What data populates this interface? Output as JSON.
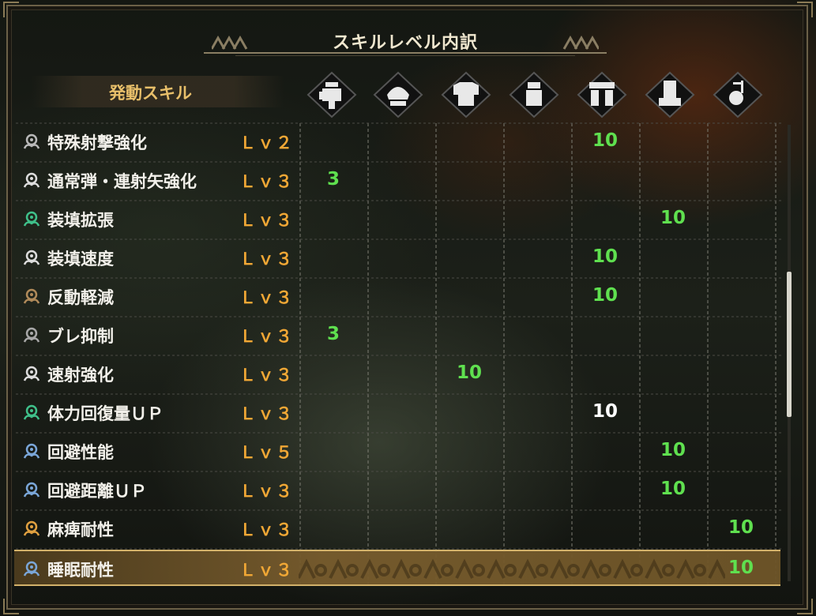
{
  "title": "スキルレベル内訳",
  "header_label": "発動スキル",
  "colors": {
    "value_green": "#5fe04f",
    "value_white": "#ffffff",
    "level_orange": "#f0a735",
    "header_gold": "#e8bf6a"
  },
  "equipment_slots": [
    {
      "name": "weapon-icon"
    },
    {
      "name": "helm-icon"
    },
    {
      "name": "chest-icon"
    },
    {
      "name": "arms-icon"
    },
    {
      "name": "waist-icon"
    },
    {
      "name": "legs-icon"
    },
    {
      "name": "talisman-icon"
    }
  ],
  "skills": [
    {
      "name": "特殊射撃強化",
      "level": "Ｌｖ２",
      "icon_color": "#b9b9b9",
      "values": [
        "",
        "",
        "",
        "",
        "10",
        "",
        ""
      ],
      "white_cols": []
    },
    {
      "name": "通常弾・連射矢強化",
      "level": "Ｌｖ３",
      "icon_color": "#dcdcdc",
      "values": [
        "3",
        "",
        "",
        "",
        "",
        "",
        ""
      ],
      "white_cols": []
    },
    {
      "name": "装填拡張",
      "level": "Ｌｖ３",
      "icon_color": "#3fc08a",
      "values": [
        "",
        "",
        "",
        "",
        "",
        "10",
        ""
      ],
      "white_cols": []
    },
    {
      "name": "装填速度",
      "level": "Ｌｖ３",
      "icon_color": "#dcdcdc",
      "values": [
        "",
        "",
        "",
        "",
        "10",
        "",
        ""
      ],
      "white_cols": []
    },
    {
      "name": "反動軽減",
      "level": "Ｌｖ３",
      "icon_color": "#b08a5a",
      "values": [
        "",
        "",
        "",
        "",
        "10",
        "",
        ""
      ],
      "white_cols": []
    },
    {
      "name": "ブレ抑制",
      "level": "Ｌｖ３",
      "icon_color": "#a7a7a7",
      "values": [
        "3",
        "",
        "",
        "",
        "",
        "",
        ""
      ],
      "white_cols": []
    },
    {
      "name": "速射強化",
      "level": "Ｌｖ３",
      "icon_color": "#dcdcdc",
      "values": [
        "",
        "",
        "10",
        "",
        "",
        "",
        ""
      ],
      "white_cols": []
    },
    {
      "name": "体力回復量ＵＰ",
      "level": "Ｌｖ３",
      "icon_color": "#3fc08a",
      "values": [
        "",
        "",
        "",
        "",
        "10",
        "",
        ""
      ],
      "white_cols": [
        4
      ]
    },
    {
      "name": "回避性能",
      "level": "Ｌｖ５",
      "icon_color": "#7aa6d8",
      "values": [
        "",
        "",
        "",
        "",
        "",
        "10",
        ""
      ],
      "white_cols": []
    },
    {
      "name": "回避距離ＵＰ",
      "level": "Ｌｖ３",
      "icon_color": "#7aa6d8",
      "values": [
        "",
        "",
        "",
        "",
        "",
        "10",
        ""
      ],
      "white_cols": []
    },
    {
      "name": "麻痺耐性",
      "level": "Ｌｖ３",
      "icon_color": "#e0a040",
      "values": [
        "",
        "",
        "",
        "",
        "",
        "",
        "10"
      ],
      "white_cols": []
    },
    {
      "name": "睡眠耐性",
      "level": "Ｌｖ３",
      "icon_color": "#7aa6d8",
      "values": [
        "",
        "",
        "",
        "",
        "",
        "",
        "10"
      ],
      "white_cols": [],
      "selected": true
    }
  ]
}
